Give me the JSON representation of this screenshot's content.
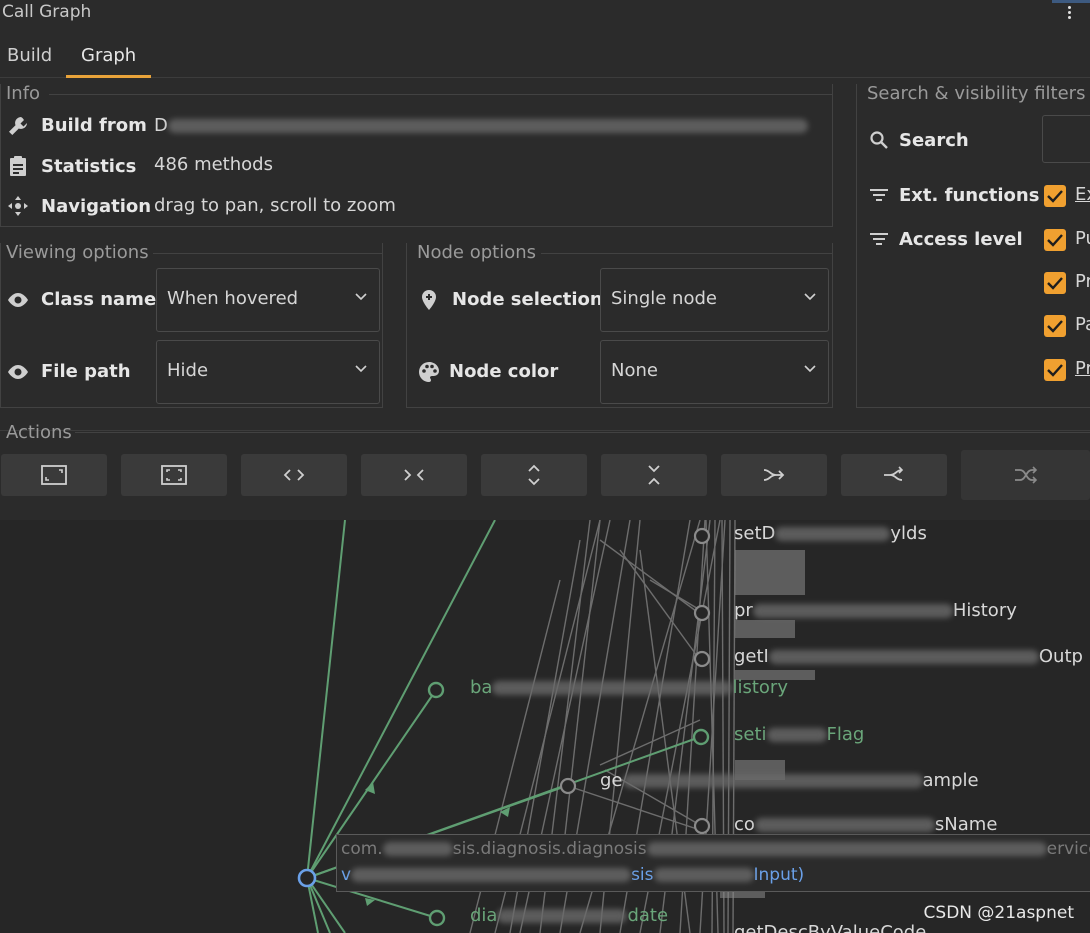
{
  "window": {
    "title": "Call Graph"
  },
  "tabs": [
    {
      "label": "Build"
    },
    {
      "label": "Graph"
    }
  ],
  "info": {
    "legend": "Info",
    "build_from": {
      "label": "Build from",
      "value_prefix": "D"
    },
    "statistics": {
      "label": "Statistics",
      "value": "486 methods"
    },
    "navigation": {
      "label": "Navigation",
      "value": "drag to pan, scroll to zoom"
    }
  },
  "viewing": {
    "legend": "Viewing options",
    "class_name": {
      "label": "Class name",
      "value": "When hovered"
    },
    "file_path": {
      "label": "File path",
      "value": "Hide"
    }
  },
  "node": {
    "legend": "Node options",
    "selection": {
      "label": "Node selection",
      "value": "Single node"
    },
    "color": {
      "label": "Node color",
      "value": "None"
    }
  },
  "filters": {
    "legend": "Search & visibility filters",
    "search_label": "Search",
    "ext_label": "Ext. functions",
    "access_label": "Access level",
    "checks": [
      "Ex",
      "Pu",
      "Pr",
      "Pa",
      "Pr"
    ]
  },
  "actions": {
    "legend": "Actions"
  },
  "graph": {
    "labels": [
      {
        "prefix": "setD",
        "suffix": "ylds"
      },
      {
        "prefix": "pr",
        "suffix": "History"
      },
      {
        "prefix": "getI",
        "suffix": "Outp"
      },
      {
        "prefix": "ba",
        "suffix": "listory"
      },
      {
        "prefix": "seti",
        "suffix": "Flag"
      },
      {
        "prefix": "ge",
        "suffix": "ample"
      },
      {
        "prefix": "co",
        "suffix": "sName"
      },
      {
        "prefix": "dia",
        "suffix": "date"
      },
      {
        "prefix": "getDescByValueCode",
        "suffix": ""
      }
    ],
    "tooltip": {
      "line1": "com.",
      "line1_mid": "sis.diagnosis.diagnosis",
      "line1_end": "ervice",
      "line2_prefix": "v",
      "line2_mid": "sis",
      "line2_end": "Input)"
    },
    "colors": {
      "edge_green": "#5f9e72",
      "edge_gray": "#7a7a7a",
      "node_selected": "#6aa0e8"
    }
  },
  "watermark": "CSDN @21aspnet",
  "colors": {
    "accent": "#e8a33a",
    "checkbox": "#f0a030"
  }
}
